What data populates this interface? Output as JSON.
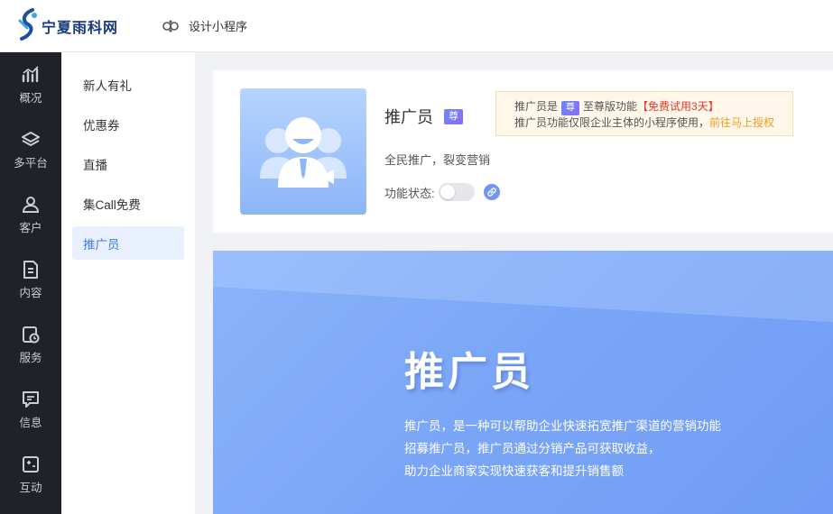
{
  "header": {
    "logo_text": "宁夏雨科网",
    "app_switch_label": "设计小程序"
  },
  "leftnav": [
    {
      "label": "概况",
      "icon": "chart-bars-icon"
    },
    {
      "label": "多平台",
      "icon": "layers-icon"
    },
    {
      "label": "客户",
      "icon": "user-icon"
    },
    {
      "label": "内容",
      "icon": "document-icon"
    },
    {
      "label": "服务",
      "icon": "service-clock-icon"
    },
    {
      "label": "信息",
      "icon": "message-icon"
    },
    {
      "label": "互动",
      "icon": "interact-icon"
    }
  ],
  "submenu": [
    {
      "label": "新人有礼",
      "active": false
    },
    {
      "label": "优惠券",
      "active": false
    },
    {
      "label": "直播",
      "active": false
    },
    {
      "label": "集Call免费",
      "active": false
    },
    {
      "label": "推广员",
      "active": true
    }
  ],
  "plugin": {
    "title": "推广员",
    "badge": "尊",
    "desc": "全民推广，裂变营销",
    "status_label": "功能状态:",
    "status_on": false
  },
  "notice": {
    "line1_prefix": "推广员是",
    "badge": "尊",
    "line1_suffix": "至尊版功能",
    "trial": "【免费试用3天】",
    "line2_prefix": "推广员功能仅限企业主体的小程序使用，",
    "line2_link": "前往马上授权"
  },
  "banner": {
    "title": "推广员",
    "lines": [
      "推广员，是一种可以帮助企业快速拓宽推广渠道的营销功能",
      "招募推广员，推广员通过分销产品可获取收益，",
      "助力企业商家实现快速获客和提升销售额"
    ]
  },
  "colors": {
    "accent": "#3d7af5",
    "nav_bg": "#1f2329",
    "red": "#e5372b",
    "orange": "#f39a1f"
  }
}
